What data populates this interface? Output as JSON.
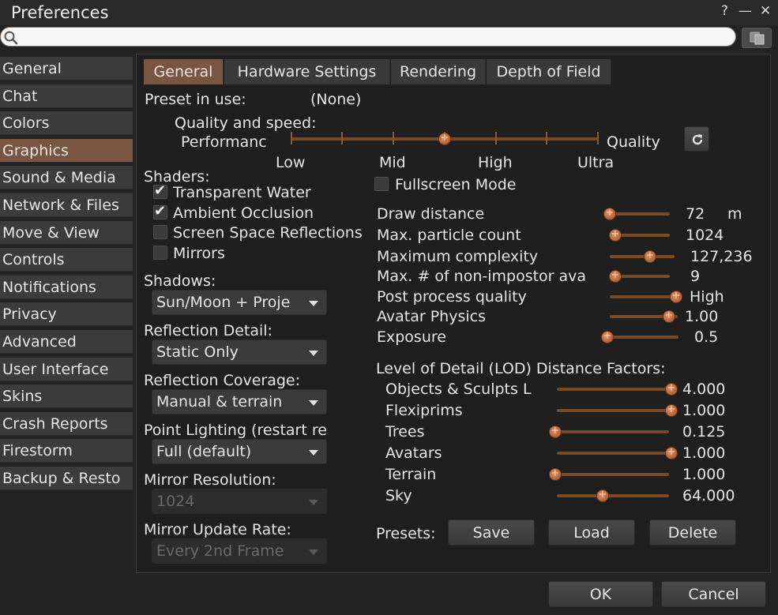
{
  "window": {
    "title": "Preferences",
    "help_label": "?",
    "minimize_label": "—",
    "close_label": "✕"
  },
  "search": {
    "value": "",
    "placeholder": ""
  },
  "sidebar": {
    "items": [
      {
        "label": "General"
      },
      {
        "label": "Chat"
      },
      {
        "label": "Colors"
      },
      {
        "label": "Graphics"
      },
      {
        "label": "Sound & Media"
      },
      {
        "label": "Network & Files"
      },
      {
        "label": "Move & View"
      },
      {
        "label": "Controls"
      },
      {
        "label": "Notifications"
      },
      {
        "label": "Privacy"
      },
      {
        "label": "Advanced"
      },
      {
        "label": "User Interface"
      },
      {
        "label": "Skins"
      },
      {
        "label": "Crash Reports"
      },
      {
        "label": "Firestorm"
      },
      {
        "label": "Backup & Resto"
      }
    ],
    "active_index": 3
  },
  "tabs": [
    {
      "label": "General"
    },
    {
      "label": "Hardware Settings"
    },
    {
      "label": "Rendering"
    },
    {
      "label": "Depth of Field"
    }
  ],
  "preset": {
    "label": "Preset in use:",
    "value": "(None)"
  },
  "quality": {
    "label": "Quality and speed:",
    "left_label": "Performanc",
    "right_label": "Quality",
    "ticks": [
      "Low",
      "Mid",
      "High",
      "Ultra"
    ],
    "level_fraction": 0.5
  },
  "shaders": {
    "label": "Shaders:",
    "items": [
      {
        "label": "Transparent Water",
        "checked": true
      },
      {
        "label": "Ambient Occlusion",
        "checked": true
      },
      {
        "label": "Screen Space Reflections",
        "checked": false
      },
      {
        "label": "Mirrors",
        "checked": false
      }
    ]
  },
  "fullscreen": {
    "label": "Fullscreen Mode",
    "checked": false
  },
  "dropdowns": {
    "shadows": {
      "label": "Shadows:",
      "value": "Sun/Moon + Proje"
    },
    "reflection_detail": {
      "label": "Reflection Detail:",
      "value": "Static Only"
    },
    "reflection_coverage": {
      "label": "Reflection Coverage:",
      "value": "Manual & terrain"
    },
    "point_lighting": {
      "label": "Point Lighting (restart re",
      "value": "Full (default)"
    },
    "mirror_resolution": {
      "label": "Mirror Resolution:",
      "value": "1024",
      "disabled": true
    },
    "mirror_update_rate": {
      "label": "Mirror Update Rate:",
      "value": "Every 2nd Frame",
      "disabled": true
    }
  },
  "sliders": [
    {
      "label": "Draw distance",
      "value": "72",
      "unit": "m",
      "fraction": 0.0
    },
    {
      "label": "Max. particle count",
      "value": "1024",
      "fraction": 0.0
    },
    {
      "label": "Maximum complexity",
      "value": "127,236",
      "fraction": 0.65
    },
    {
      "label": "Max. # of non-impostor ava",
      "value": "9",
      "fraction": 0.0
    },
    {
      "label": "Post process quality",
      "value": "High",
      "fraction": 1.0
    },
    {
      "label": "Avatar Physics",
      "value": "1.00",
      "fraction": 0.95
    },
    {
      "label": "Exposure",
      "value": "0.5",
      "fraction": 0.0
    }
  ],
  "lod": {
    "label": "Level of Detail (LOD) Distance Factors:",
    "items": [
      {
        "label": "Objects & Sculpts L",
        "value": "4.000",
        "fraction": 1.0
      },
      {
        "label": "Flexiprims",
        "value": "1.000",
        "fraction": 1.0
      },
      {
        "label": "Trees",
        "value": "0.125",
        "fraction": 0.0
      },
      {
        "label": "Avatars",
        "value": "1.000",
        "fraction": 1.0
      },
      {
        "label": "Terrain",
        "value": "1.000",
        "fraction": 0.0
      },
      {
        "label": "Sky",
        "value": "64.000",
        "fraction": 0.4
      }
    ]
  },
  "presets": {
    "label": "Presets:",
    "save": "Save",
    "load": "Load",
    "delete": "Delete"
  },
  "footer": {
    "ok": "OK",
    "cancel": "Cancel"
  },
  "colors": {
    "accent": "#7a5541",
    "slider_track": "#7a4a22",
    "knob": "#c06a3a",
    "background": "#232323"
  }
}
